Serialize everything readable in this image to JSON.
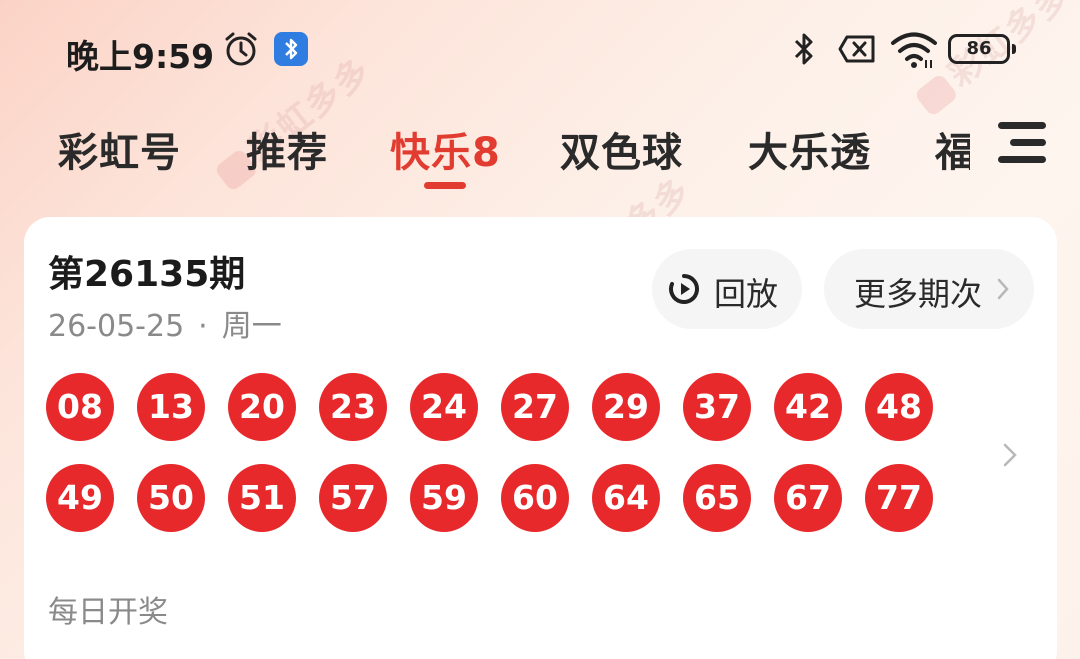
{
  "status_bar": {
    "time": "晚上9:59",
    "battery_level": "86",
    "icons": [
      "alarm-icon",
      "bluetooth-icon",
      "no-sim-icon",
      "wifi-icon",
      "battery-icon"
    ]
  },
  "tabs": [
    {
      "label": "彩虹号",
      "active": false
    },
    {
      "label": "推荐",
      "active": false
    },
    {
      "label": "快乐8",
      "active": true
    },
    {
      "label": "双色球",
      "active": false
    },
    {
      "label": "大乐透",
      "active": false
    },
    {
      "label": "福",
      "active": false
    }
  ],
  "watermark": "彩虹多多",
  "card": {
    "issue_title": "第26135期",
    "date": "26-05-25",
    "separator": "·",
    "weekday": "周一",
    "replay_label": "回放",
    "more_label": "更多期次",
    "balls_row1": [
      "08",
      "13",
      "20",
      "23",
      "24",
      "27",
      "29",
      "37",
      "42",
      "48"
    ],
    "balls_row2": [
      "49",
      "50",
      "51",
      "57",
      "59",
      "60",
      "64",
      "65",
      "67",
      "77"
    ],
    "frequency": "每日开奖"
  },
  "colors": {
    "accent": "#e23b30",
    "ball": "#e7292c",
    "muted_text": "#8a8a8a"
  }
}
